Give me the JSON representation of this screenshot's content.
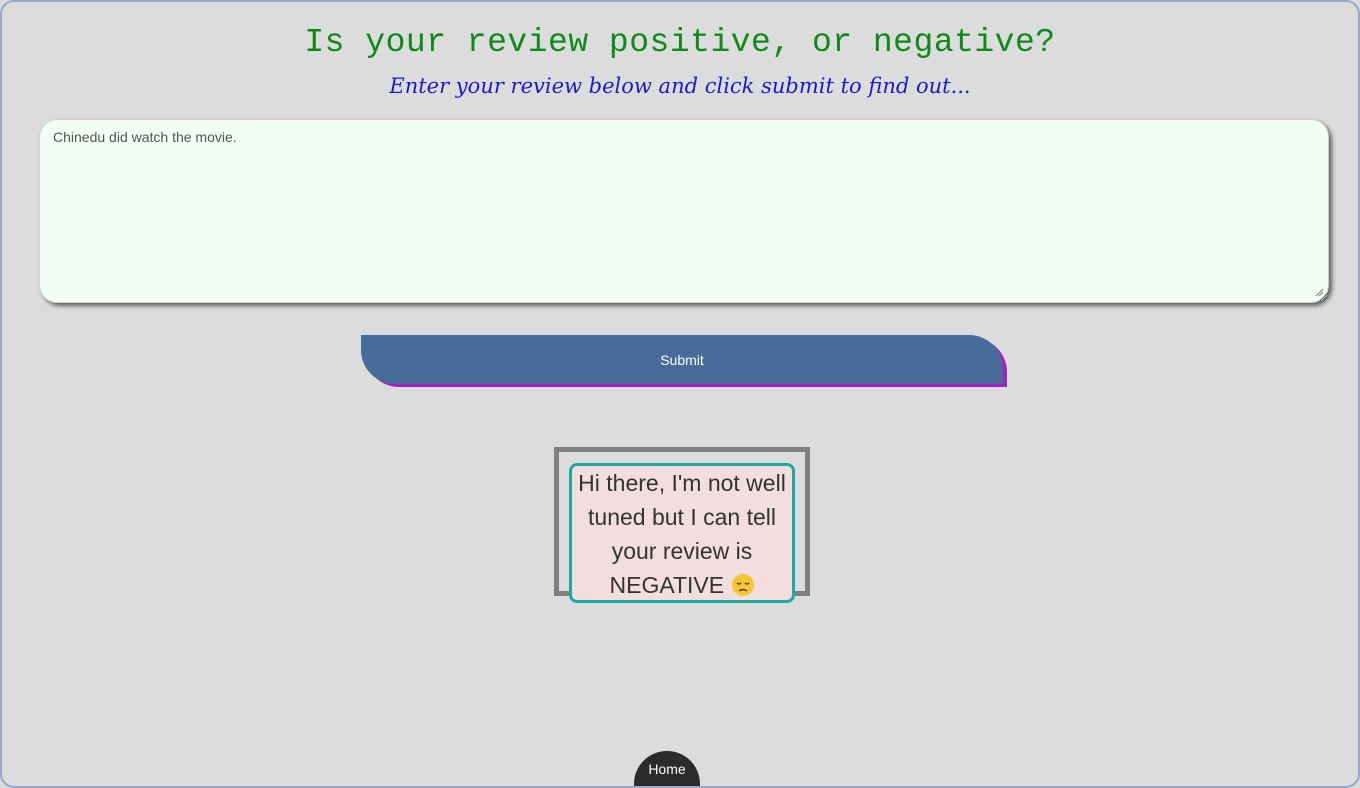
{
  "header": {
    "title": "Is your review positive, or negative?",
    "subtitle": "Enter your review below and click submit to find out..."
  },
  "review": {
    "value": "Chinedu did watch the movie."
  },
  "form": {
    "submit_label": "Submit"
  },
  "result": {
    "text": "Hi there, I'm not well tuned but I can tell your review is NEGATIVE",
    "sentiment": "NEGATIVE",
    "emoji_icon": "disappointed-face-icon"
  },
  "nav": {
    "home_label": "Home"
  },
  "colors": {
    "title": "#0f8a1a",
    "subtitle": "#1a1acc",
    "submit_bg": "#486c9a",
    "submit_shadow": "#a020c8",
    "result_border": "#20a8a0",
    "result_bg": "#f2dede",
    "home_bg": "#2b2b2b"
  }
}
